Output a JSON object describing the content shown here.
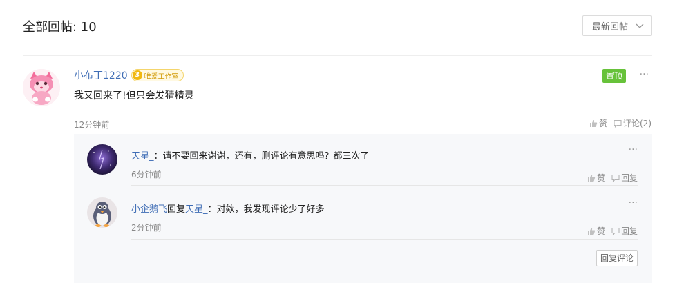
{
  "header": {
    "total_label": "全部回帖: 10",
    "sort_selected": "最新回帖"
  },
  "comment": {
    "username": "小布丁1220",
    "badge_level": "3",
    "badge_text": "唯爱工作室",
    "pin_label": "置顶",
    "more_label": "···",
    "text": "我又回来了!但只会发猜精灵",
    "time": "12分钟前",
    "like_label": "赞",
    "comment_label": "评论(2)"
  },
  "replies": [
    {
      "username": "天星_",
      "separator": "：",
      "text": "请不要回来谢谢，还有，删评论有意思吗？都三次了",
      "time": "6分钟前",
      "like_label": "赞",
      "reply_label": "回复",
      "more_label": "···"
    },
    {
      "username": "小企鹅飞",
      "reply_word": "回复",
      "target": "天星_",
      "separator": "：",
      "text": "对欸，我发现评论少了好多",
      "time": "2分钟前",
      "like_label": "赞",
      "reply_label": "回复",
      "more_label": "···"
    }
  ],
  "reply_comment_button": "回复评论",
  "colors": {
    "link": "#3f6db5",
    "pin": "#67c23a",
    "badge_border": "#f4d56c",
    "reply_bg": "#f7f8fa"
  },
  "icons": [
    "chevron-down-icon",
    "thumb-up-icon",
    "comment-icon",
    "more-icon"
  ]
}
